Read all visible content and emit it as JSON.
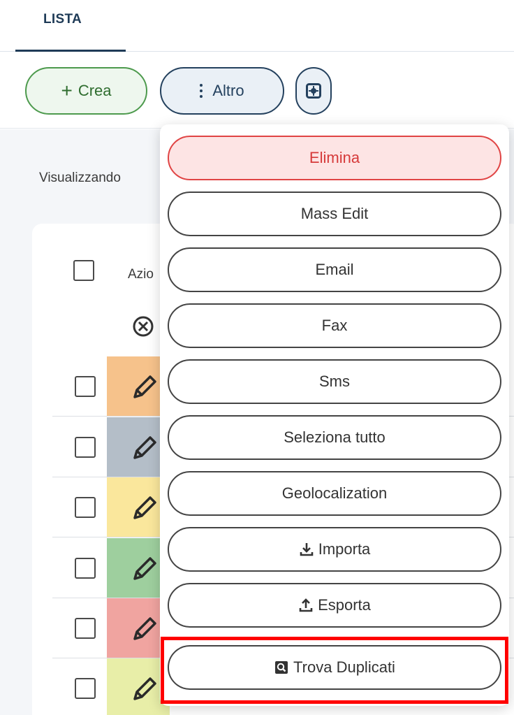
{
  "tabs": {
    "active_label": "LISTA"
  },
  "toolbar": {
    "crea_label": "Crea",
    "altro_label": "Altro"
  },
  "content": {
    "visualizzando_text": "Visualizzando",
    "azioni_header_partial": "Azio"
  },
  "rows": [
    {
      "color": "#f6c28b"
    },
    {
      "color": "#b4bec8"
    },
    {
      "color": "#fae79c"
    },
    {
      "color": "#9ecf9e"
    },
    {
      "color": "#f0a4a0"
    },
    {
      "color": "#e8eea8"
    }
  ],
  "dropdown": {
    "items": [
      {
        "label": "Elimina",
        "variant": "danger"
      },
      {
        "label": "Mass Edit"
      },
      {
        "label": "Email"
      },
      {
        "label": "Fax"
      },
      {
        "label": "Sms"
      },
      {
        "label": "Seleziona tutto"
      },
      {
        "label": "Geolocalization"
      },
      {
        "label": "Importa",
        "icon": "download-icon"
      },
      {
        "label": "Esporta",
        "icon": "upload-icon"
      },
      {
        "label": "Trova Duplicati",
        "icon": "search-duplicates-icon"
      }
    ]
  },
  "colors": {
    "primary": "#24415e",
    "create": "#4d9a4d",
    "danger": "#e04444",
    "highlight": "#ff0000"
  }
}
